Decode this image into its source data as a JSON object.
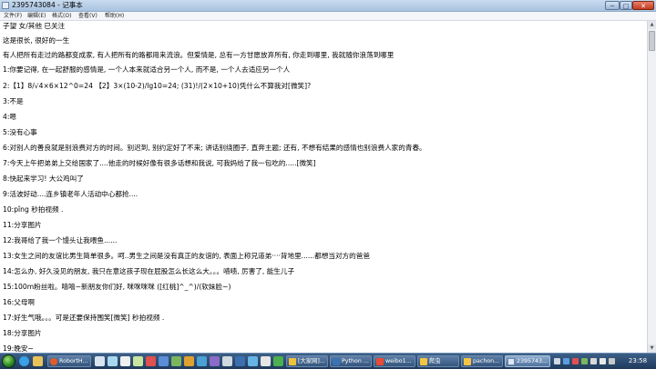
{
  "window": {
    "title": "2395743084 - 记事本",
    "minimize": "─",
    "maximize": "□",
    "close": "✕"
  },
  "menu": [
    "文件(F)",
    "编辑(E)",
    "格式(O)",
    "查看(V)",
    "帮助(H)"
  ],
  "lines": [
    "子望  女/其他           已关注",
    "这是很长, 很好的一生",
    "有人把所有走过的路都变成家, 有人把所有的路都用来流浪。但爱情是, 总有一方甘愿放弃所有, 你走到哪里, 我就随你浪荡到哪里",
    "1:你要记得, 在一起舒服的感情是, 一个人本来就适合另一个人, 而不是, 一个人去适应另一个人",
    "2:【1】8/√4×6×12^0=24 【2】3×(10-2)/lg10=24; (31)!/(2×10+10)凭什么不算我对[微笑]?",
    "3:不是",
    "4:嗯",
    "5:没有心事",
    "6:对别人的善良就是别浪费对方的时间。别迟到, 别约定好了不来; 讲话别绕圈子, 直奔主题; 还有, 不想有结果的感情也别浪费人家的青春。",
    "7:今天上午把弟弟上交给国家了....他走的时候好像有很多话想和我说, 可我妈给了我一包吃的.....[微笑]",
    "8:快起来学习! 大公鸡叫了",
    "9:活波好动....连乡镇老年人活动中心都抢....",
    "10:pǐng 秒拍视频 .",
    "11:分享图片",
    "12:我哥给了我一个馒头让我喂鱼......",
    "13:女生之间的友谊比男生简单很多。呵..男生之间是没有真正的友谊的, 表面上称兄道弟····背地里......都想当对方的爸爸",
    "14:怎么办, 好久没见的朋友, 我只在意这孩子现在屁股怎么长这么大。。。啧啧, 厉害了, 能生儿子",
    "15:100m粉丝啦。嘻嘻~新朋友你们好, 咪咪咪咪 ([红桃]^_^)/(软妹脸~)",
    "16:父母啊",
    "17:好生气哦。。。可是还要保持围笑[微笑] 秒拍视频 .",
    "18:分享图片",
    "19:晚安~"
  ],
  "taskbar": {
    "tasks": [
      {
        "label": "RobortH...",
        "active": false,
        "color": "#e25b2b"
      },
      {
        "label": "[大家网]...",
        "active": false,
        "color": "#f0c23a"
      },
      {
        "label": "Python ...",
        "active": false,
        "color": "#3b72b5"
      },
      {
        "label": "weibo1...",
        "active": false,
        "color": "#e94b35"
      },
      {
        "label": "爬虫",
        "active": false,
        "color": "#f4c542"
      },
      {
        "label": "pachon...",
        "active": false,
        "color": "#f4c542"
      },
      {
        "label": "2395743...",
        "active": true,
        "color": "#dfe7f2"
      }
    ],
    "clock": "23:58"
  }
}
